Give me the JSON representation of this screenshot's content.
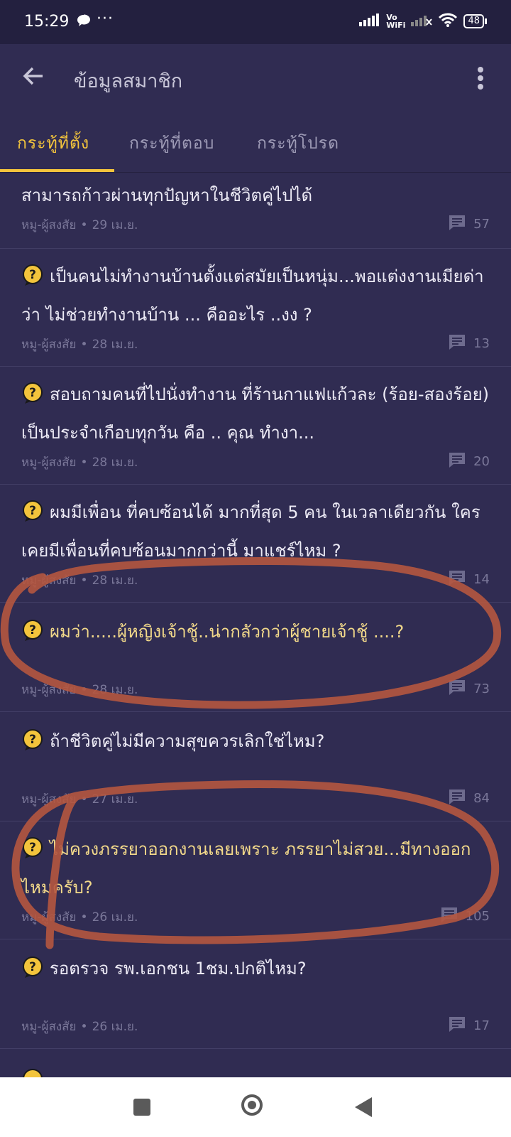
{
  "status_bar": {
    "time": "15:29",
    "dots": "···",
    "vowifi_top": "Vo",
    "vowifi_bottom": "WiFi",
    "battery": "48"
  },
  "header": {
    "title": "ข้อมูลสมาชิก",
    "back_icon": "arrow-left-icon",
    "menu_icon": "more-vertical-icon"
  },
  "tabs": [
    {
      "label": "กระทู้ที่ตั้ง",
      "active": true
    },
    {
      "label": "กระทู้ที่ตอบ",
      "active": false
    },
    {
      "label": "กระทู้โปรด",
      "active": false
    }
  ],
  "posts": [
    {
      "title": "สามารถก้าวผ่านทุกปัญหาในชีวิตคู่ไปได้",
      "author": "หมู-ผู้สงสัย",
      "date": "29 เม.ย.",
      "replies": "57"
    },
    {
      "title": "เป็นคนไม่ทำงานบ้านตั้งแต่สมัยเป็นหนุ่ม...พอแต่งงานเมียด่าว่า ไม่ช่วยทำงานบ้าน ... คืออะไร ..งง ?",
      "author": "หมู-ผู้สงสัย",
      "date": "28 เม.ย.",
      "replies": "13"
    },
    {
      "title": "สอบถามคนที่ไปนั่งทำงาน ที่ร้านกาแฟแก้วละ (ร้อย-สองร้อย) เป็นประจำเกือบทุกวัน คือ .. คุณ ทำงา...",
      "author": "หมู-ผู้สงสัย",
      "date": "28 เม.ย.",
      "replies": "20"
    },
    {
      "title": "ผมมีเพื่อน ที่คบซ้อนได้ มากที่สุด 5 คน ในเวลาเดียวกัน ใครเคยมีเพื่อนที่คบซ้อนมากกว่านี้ มาแชร์ไหม ?",
      "author": "หมู-ผู้สงสัย",
      "date": "28 เม.ย.",
      "replies": "14"
    },
    {
      "title": "ผมว่า.....ผู้หญิงเจ้าชู้..น่ากลัวกว่าผู้ชายเจ้าชู้ ....?",
      "author": "หมู-ผู้สงสัย",
      "date": "28 เม.ย.",
      "replies": "73",
      "visited": true
    },
    {
      "title": "ถ้าชีวิตคู่ไม่มีความสุขควรเลิกใช่ไหม?",
      "author": "หมู-ผู้สงสัย",
      "date": "27 เม.ย.",
      "replies": "84"
    },
    {
      "title": "ไม่ควงภรรยาออกงานเลยเพราะ ภรรยาไม่สวย...มีทางออกไหมครับ?",
      "author": "หมู-ผู้สงสัย",
      "date": "26 เม.ย.",
      "replies": "105",
      "visited": true
    },
    {
      "title": "รอตรวจ รพ.เอกชน 1ชม.ปกติไหม?",
      "author": "หมู-ผู้สงสัย",
      "date": "26 เม.ย.",
      "replies": "17"
    }
  ],
  "colors": {
    "accent": "#f3c43c",
    "visited_title": "#f2d98a",
    "background": "#302c52",
    "annotation": "#b5573f"
  }
}
